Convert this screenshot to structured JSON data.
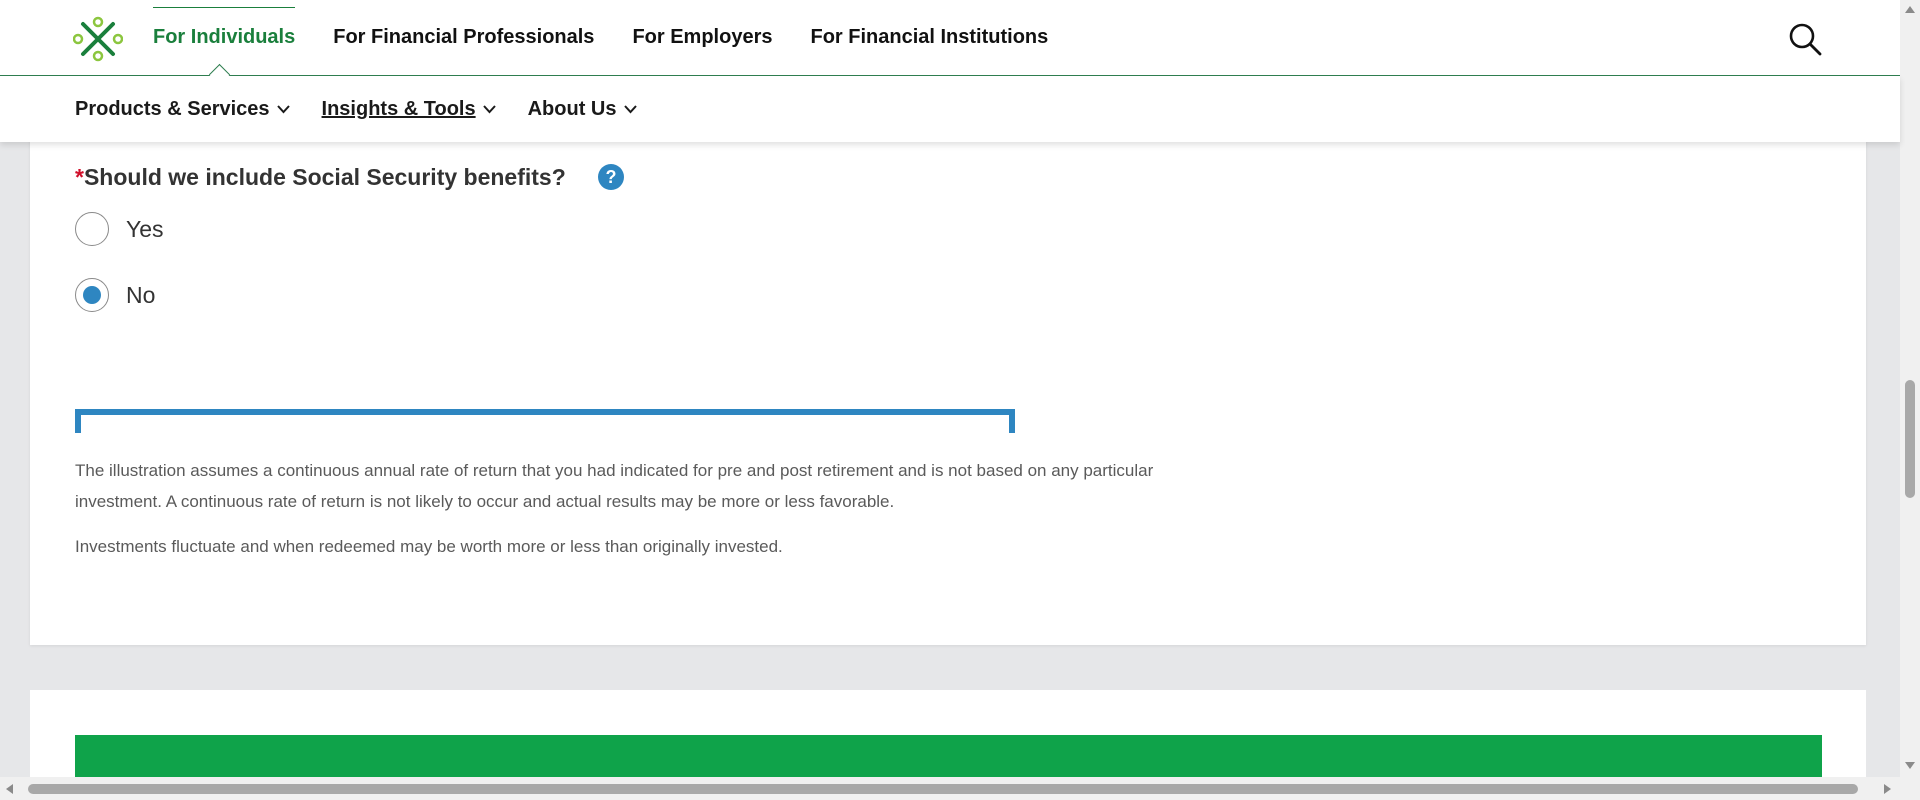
{
  "header": {
    "logo_name": "brand-logo",
    "links": [
      {
        "label": "For Individuals"
      },
      {
        "label": "For Financial Professionals"
      },
      {
        "label": "For Employers"
      },
      {
        "label": "For Financial Institutions"
      }
    ],
    "search_icon": "search-icon"
  },
  "subnav": {
    "items": [
      {
        "label": "Products & Services"
      },
      {
        "label": "Insights & Tools"
      },
      {
        "label": "About Us"
      }
    ]
  },
  "form": {
    "required_marker": "*",
    "question": "Should we include Social Security benefits?",
    "help_icon": "help-icon",
    "options": [
      {
        "label": "Yes",
        "selected": false
      },
      {
        "label": "No",
        "selected": true
      }
    ]
  },
  "disclaimer": {
    "paragraph_1": "The illustration assumes a continuous annual rate of return that you had indicated for pre and post retirement and is not based on any particular investment. A continuous rate of return is not likely to occur and actual results may be more or less favorable.",
    "paragraph_2": "Investments fluctuate and when redeemed may be worth more or less than originally invested."
  },
  "colors": {
    "brand_green": "#1a7f3c",
    "accent_blue": "#2e86c1",
    "banner_green": "#0fa34a",
    "required_red": "#d0102b"
  }
}
